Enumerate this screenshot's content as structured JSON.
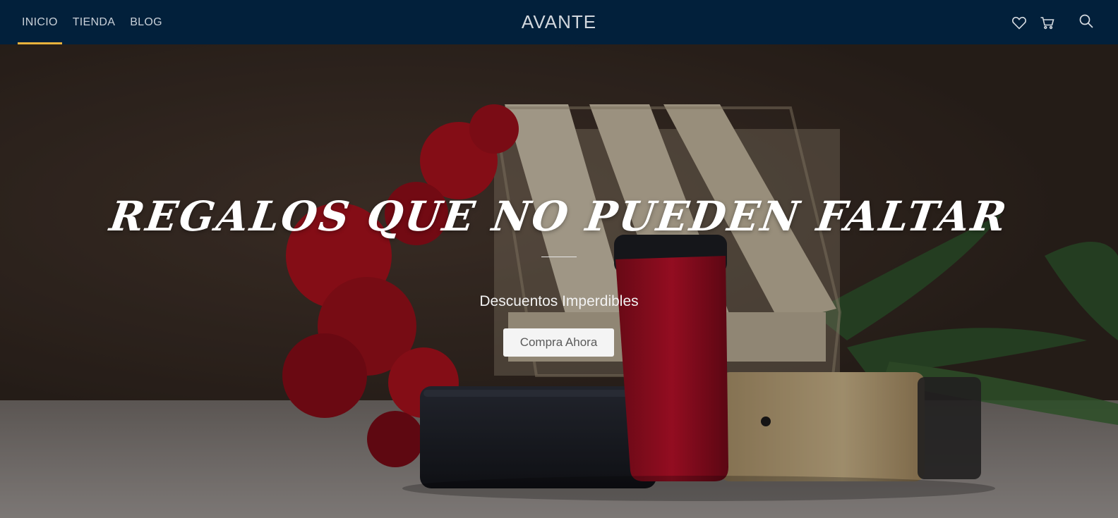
{
  "header": {
    "nav": [
      {
        "label": "INICIO",
        "active": true
      },
      {
        "label": "TIENDA",
        "active": false
      },
      {
        "label": "BLOG",
        "active": false
      }
    ],
    "logo": "AVANTE",
    "icons": [
      "heart-icon",
      "cart-icon",
      "search-icon"
    ],
    "background_color": "#02203b",
    "active_indicator_color": "#e9b23c"
  },
  "hero": {
    "title": "REGALOS QUE NO PUEDEN FALTAR",
    "subtitle": "Descuentos Imperdibles",
    "button_label": "Compra Ahora",
    "image_subject": "vape pod devices (black, red, gold) with red carnations and a wooden crate"
  }
}
